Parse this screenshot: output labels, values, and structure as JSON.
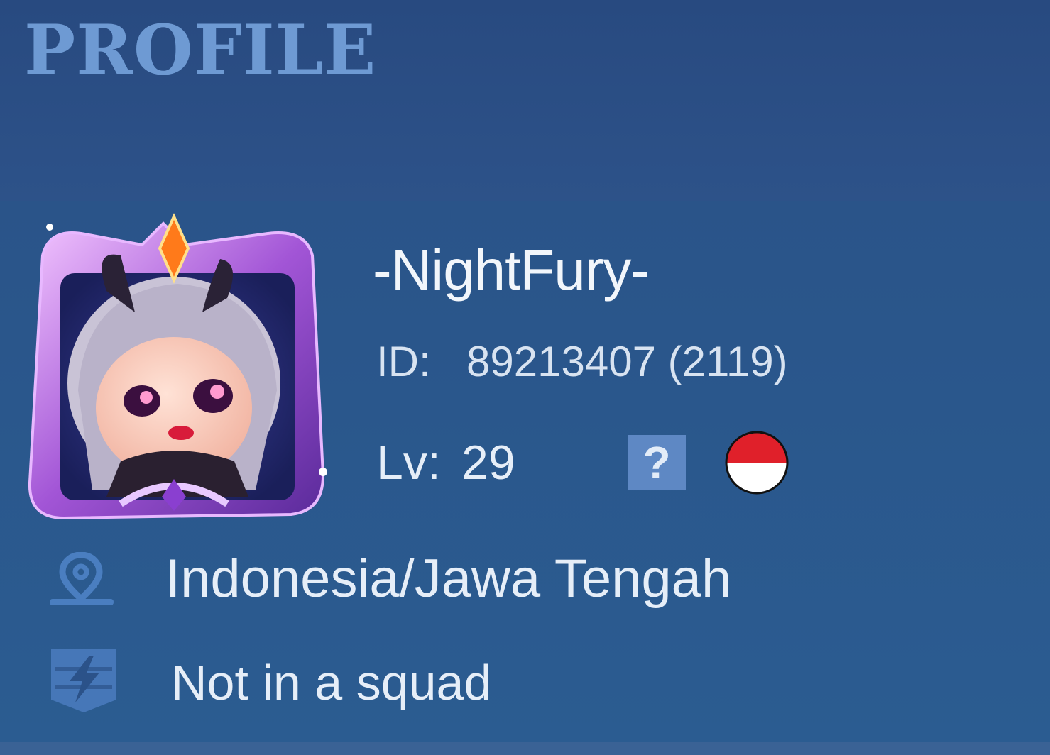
{
  "page": {
    "title": "PROFILE"
  },
  "profile": {
    "name": "-NightFury-",
    "id_label": "ID:",
    "id_value": "89213407 (2119)",
    "level_label": "Lv:",
    "level_value": "29",
    "help_badge": "?",
    "flag_icon": "indonesia-flag-icon",
    "avatar_icon": "hero-avatar-with-frame",
    "location": {
      "icon": "location-pin-icon",
      "text": "Indonesia/Jawa Tengah"
    },
    "squad": {
      "icon": "squad-shield-icon",
      "text": "Not in a squad"
    }
  },
  "colors": {
    "background": "#2b5289",
    "title": "#6e9ad3",
    "text": "#e6eef8",
    "icon": "#4a7ec0",
    "flag_red": "#e0202a",
    "flag_white": "#ffffff"
  }
}
